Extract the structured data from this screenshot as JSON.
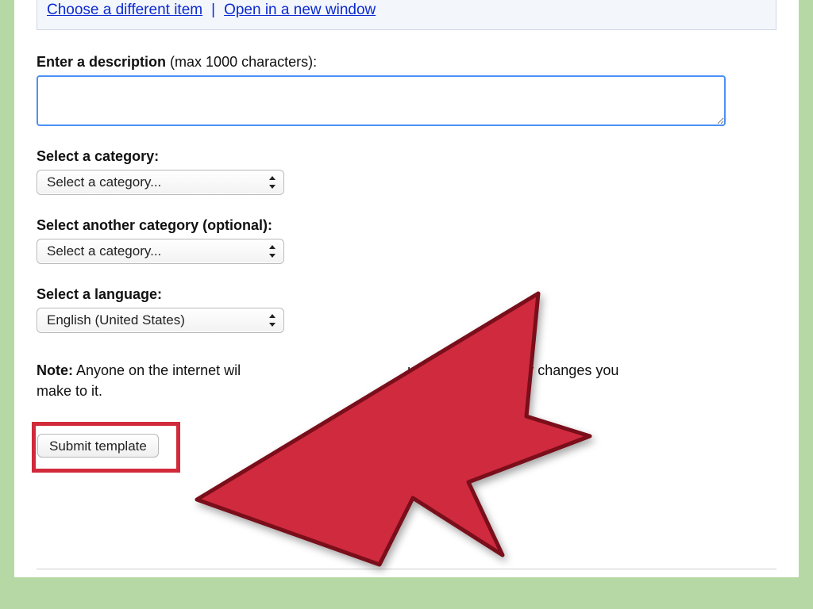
{
  "topLinks": {
    "choose": "Choose a different item",
    "sep": "|",
    "open": "Open in a new window"
  },
  "description": {
    "label_bold": "Enter a description",
    "label_rest": " (max 1000 characters):",
    "value": ""
  },
  "category1": {
    "label": "Select a category:",
    "value": "Select a category..."
  },
  "category2": {
    "label_bold": "Select another category (optional):",
    "value": "Select a category..."
  },
  "language": {
    "label": "Select a language:",
    "value": "English (United States)"
  },
  "note": {
    "prefix": "Note:",
    "line1a": " Anyone on the internet wil",
    "line1b": "ur template and any changes you",
    "line2": "make to it."
  },
  "submit": {
    "label": "Submit template"
  },
  "annotation": {
    "arrow_color": "#cf2a3e",
    "arrow_stroke": "#7a0e1a"
  }
}
